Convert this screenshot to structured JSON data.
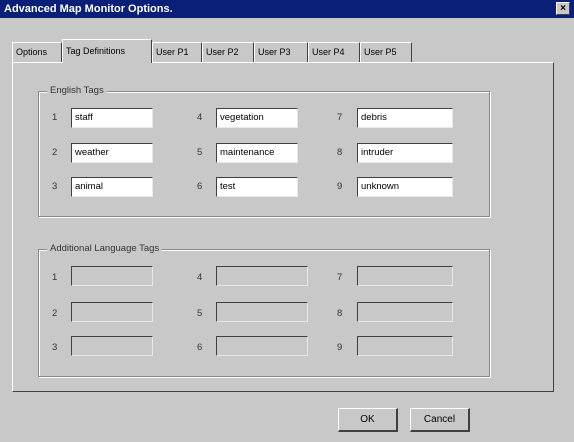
{
  "window": {
    "title": "Advanced Map Monitor Options.",
    "close_glyph": "×"
  },
  "tabs": [
    {
      "label": "Options"
    },
    {
      "label": "Tag Definitions",
      "active": true
    },
    {
      "label": "User P1"
    },
    {
      "label": "User P2"
    },
    {
      "label": "User P3"
    },
    {
      "label": "User P4"
    },
    {
      "label": "User P5"
    }
  ],
  "english_tags": {
    "label": "English Tags",
    "items": [
      {
        "num": "1",
        "value": "staff"
      },
      {
        "num": "2",
        "value": "weather"
      },
      {
        "num": "3",
        "value": "animal"
      },
      {
        "num": "4",
        "value": "vegetation"
      },
      {
        "num": "5",
        "value": "maintenance"
      },
      {
        "num": "6",
        "value": "test"
      },
      {
        "num": "7",
        "value": "debris"
      },
      {
        "num": "8",
        "value": "intruder"
      },
      {
        "num": "9",
        "value": "unknown"
      }
    ]
  },
  "additional_tags": {
    "label": "Additional Language Tags",
    "items": [
      {
        "num": "1",
        "value": ""
      },
      {
        "num": "2",
        "value": ""
      },
      {
        "num": "3",
        "value": ""
      },
      {
        "num": "4",
        "value": ""
      },
      {
        "num": "5",
        "value": ""
      },
      {
        "num": "6",
        "value": ""
      },
      {
        "num": "7",
        "value": ""
      },
      {
        "num": "8",
        "value": ""
      },
      {
        "num": "9",
        "value": ""
      }
    ]
  },
  "buttons": {
    "ok": "OK",
    "cancel": "Cancel"
  }
}
